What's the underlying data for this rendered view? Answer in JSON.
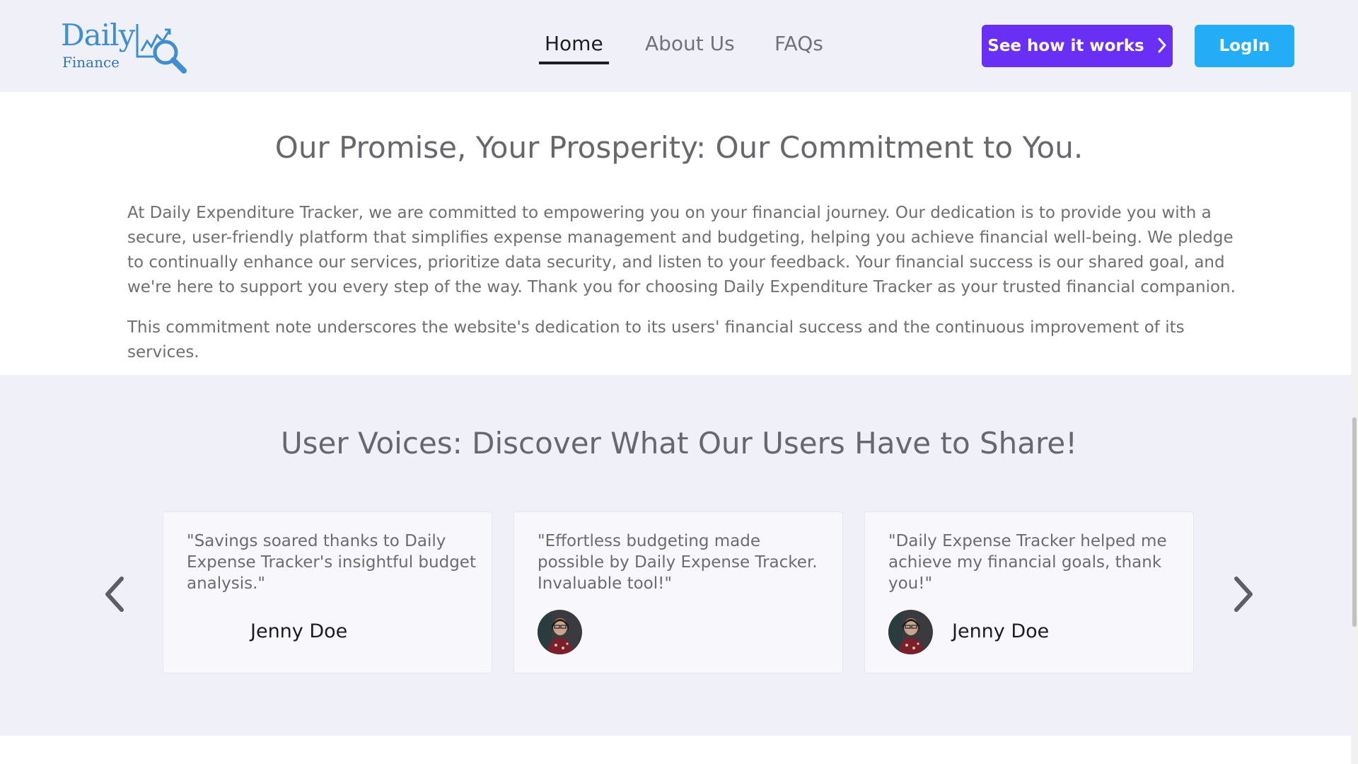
{
  "logo": {
    "word": "Daily",
    "sub": "Finance"
  },
  "nav": {
    "items": [
      {
        "label": "Home",
        "active": true
      },
      {
        "label": "About Us",
        "active": false
      },
      {
        "label": "FAQs",
        "active": false
      }
    ]
  },
  "buttons": {
    "how_it_works": "See how it works",
    "login": "LogIn"
  },
  "promise": {
    "title": "Our Promise, Your Prosperity: Our Commitment to You.",
    "paragraphs": [
      "At Daily Expenditure Tracker, we are committed to empowering you on your financial journey. Our dedication is to provide you with a secure, user-friendly platform that simplifies expense management and budgeting, helping you achieve financial well-being. We pledge to continually enhance our services, prioritize data security, and listen to your feedback. Your financial success is our shared goal, and we're here to support you every step of the way. Thank you for choosing Daily Expenditure Tracker as your trusted financial companion.",
      "This commitment note underscores the website's dedication to its users' financial success and the continuous improvement of its services."
    ]
  },
  "testimonials": {
    "title": "User Voices: Discover What Our Users Have to Share!",
    "cards": [
      {
        "quote": "\"Savings soared thanks to Daily Expense Tracker's insightful budget analysis.\"",
        "name": "Jenny Doe",
        "avatar_visible": false
      },
      {
        "quote": "\"Effortless budgeting made possible by Daily Expense Tracker. Invaluable tool!\"",
        "name": "",
        "avatar_visible": true
      },
      {
        "quote": "\"Daily Expense Tracker helped me achieve my financial goals, thank you!\"",
        "name": "Jenny Doe",
        "avatar_visible": true
      }
    ]
  },
  "colors": {
    "header_bg": "#f0f0f9",
    "primary_purple": "#6a2ff5",
    "login_blue": "#23adf6",
    "logo_blue": "#3f8ed1"
  },
  "icons": {
    "logo_mark": "chart-magnifier-icon",
    "button_chevron": "chevron-right-icon",
    "carousel_prev": "chevron-left-icon",
    "carousel_next": "chevron-right-icon"
  }
}
